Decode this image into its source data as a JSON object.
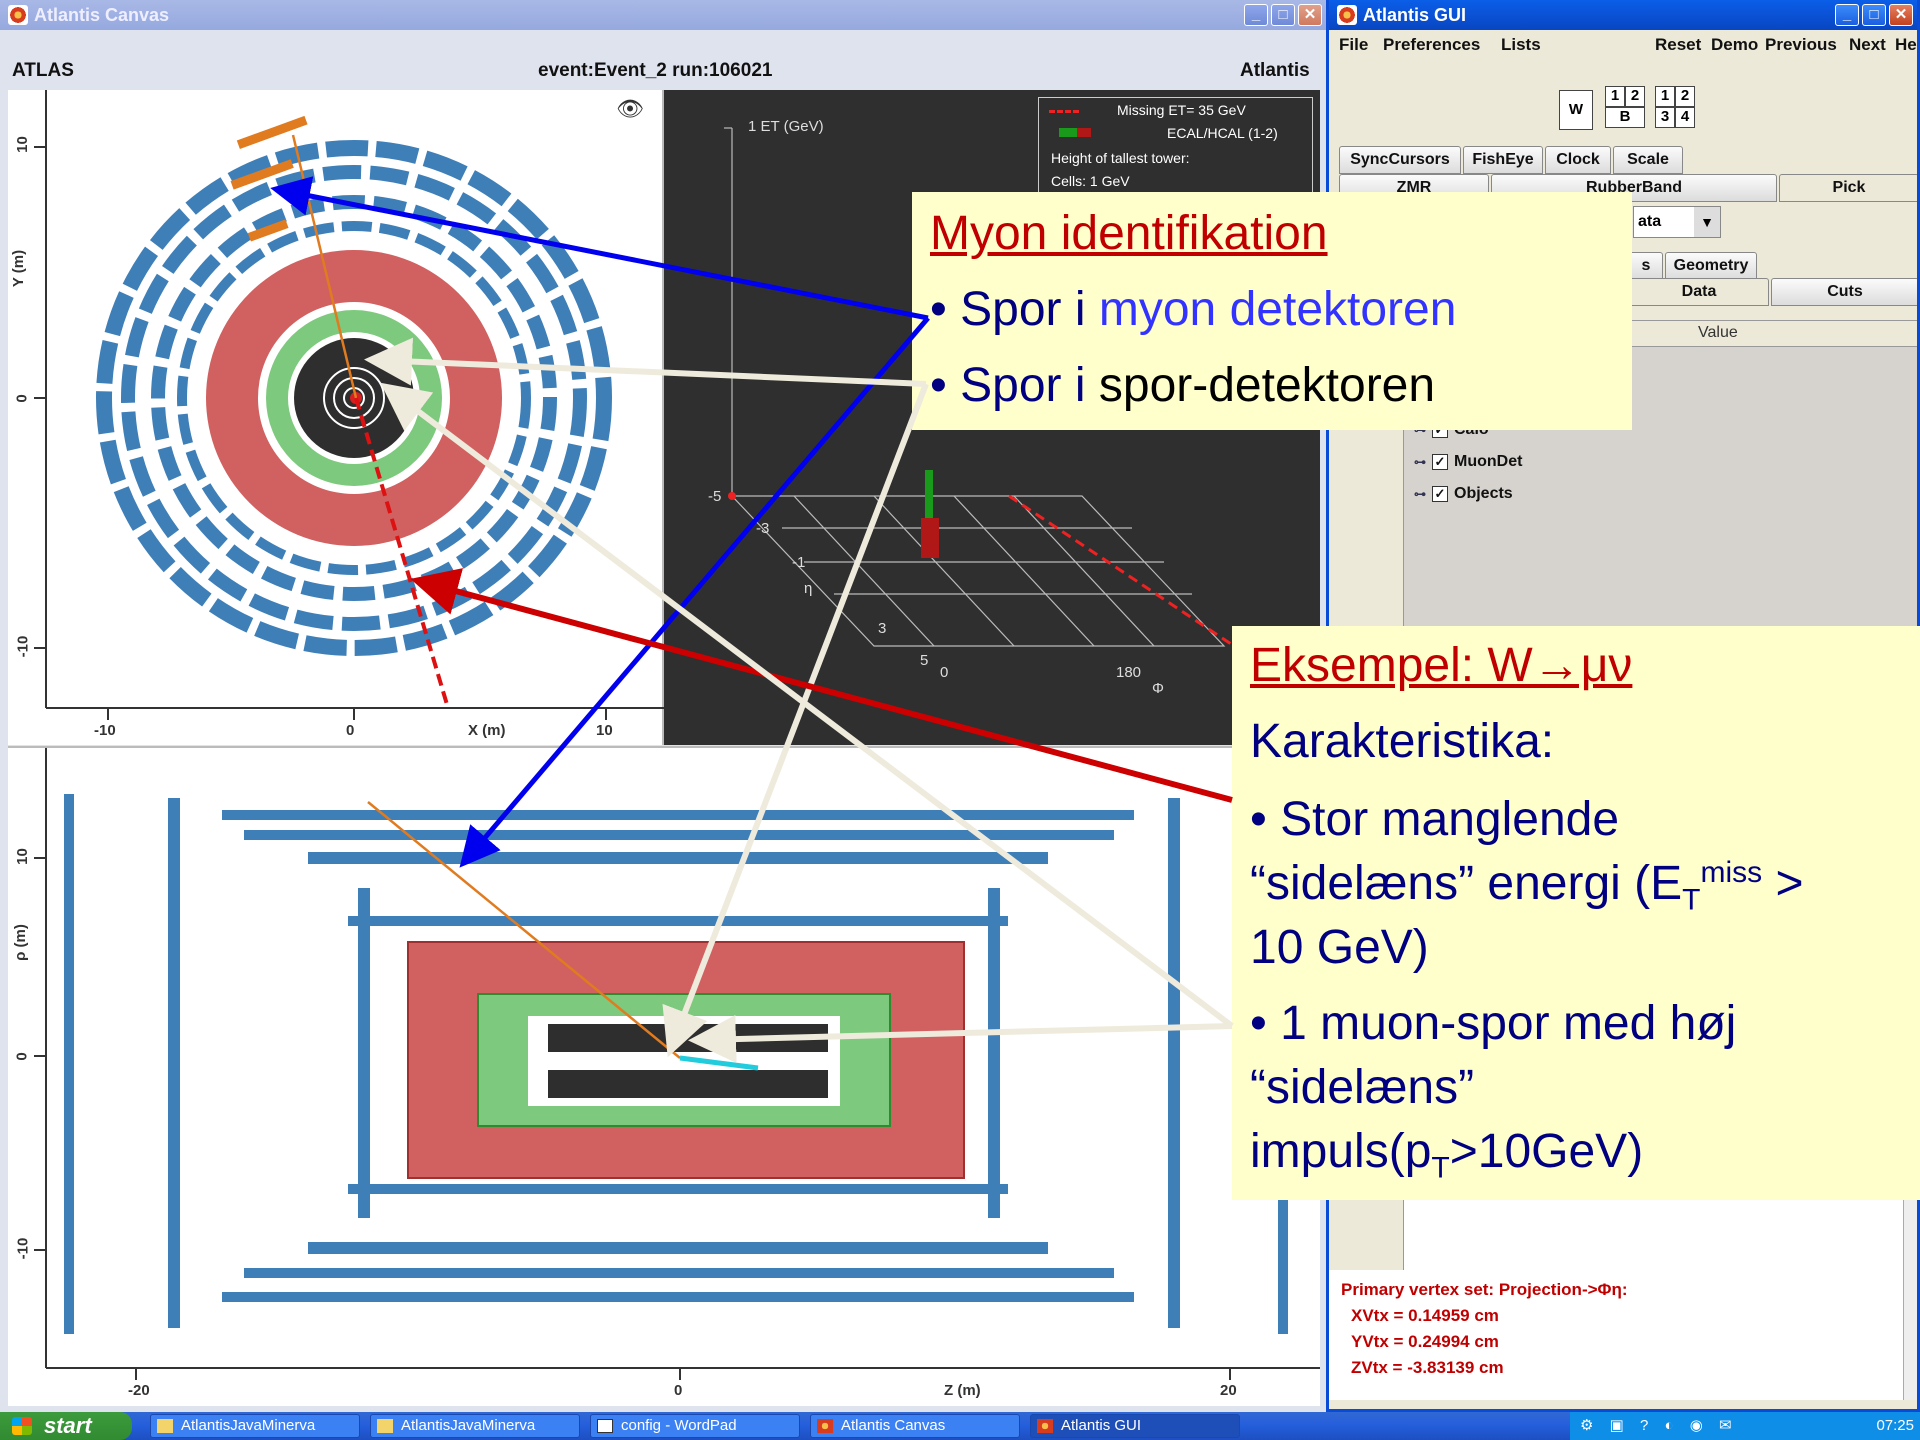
{
  "canvas_window": {
    "title": "Atlantis Canvas",
    "header_left": "ATLAS",
    "header_center": "event:Event_2 run:106021",
    "header_right": "Atlantis",
    "xy_view": {
      "y_axis_label": "Y (m)",
      "x_axis_label": "X (m)",
      "x_ticks": [
        "-10",
        "0",
        "10"
      ],
      "y_ticks": [
        "10",
        "0",
        "-10"
      ]
    },
    "lego_view": {
      "et_label": "1 ET (GeV)",
      "eta_label": "η",
      "phi_label": "Φ",
      "eta_ticks": [
        "-5",
        "-3",
        "-1",
        "3",
        "5"
      ],
      "phi_ticks": [
        "0",
        "180"
      ],
      "legend": {
        "missing_et": "Missing ET= 35 GeV",
        "ecal_hcal": "ECAL/HCAL (1-2)",
        "tallest_tower": "Height of tallest tower:",
        "cells": "Cells: 1 GeV"
      }
    },
    "rz_view": {
      "y_axis_label": "ρ (m)",
      "x_axis_label": "Z (m)",
      "x_ticks": [
        "-20",
        "0",
        "20"
      ],
      "y_ticks": [
        "10",
        "0",
        "-10"
      ]
    }
  },
  "gui_window": {
    "title": "Atlantis GUI",
    "menu": [
      "File",
      "Preferences",
      "Lists"
    ],
    "menu_right": [
      "Reset",
      "Demo",
      "Previous",
      "Next",
      "Help"
    ],
    "layout_buttons": {
      "w": "W",
      "grid_a": [
        "1",
        "2",
        "B"
      ],
      "grid_b": [
        "1",
        "2",
        "3",
        "4"
      ]
    },
    "tabs_row1": [
      "SyncCursors",
      "FishEye",
      "Clock",
      "Scale"
    ],
    "tabs_row2": [
      "ZMR",
      "RubberBand",
      "Pick"
    ],
    "dropdown_value": "ata",
    "tabs_row3": [
      "s",
      "Geometry"
    ],
    "tabs_row4": [
      "Data",
      "Cuts"
    ],
    "table_header": "Value",
    "tree": [
      "Calo",
      "MuonDet",
      "Objects"
    ],
    "vertex": {
      "line1": "Primary vertex set: Projection->Φη:",
      "line2": "XVtx = 0.14959 cm",
      "line3": "YVtx = 0.24994 cm",
      "line4": "ZVtx = -3.83139 cm"
    }
  },
  "note_muon": {
    "title": "Myon identifikation",
    "bullet1_prefix": "• Spor i ",
    "bullet1_highlight": "myon detektoren",
    "bullet2_prefix": "• Spor i ",
    "bullet2_rest": "spor-detektoren"
  },
  "note_example": {
    "title": "Eksempel: W→μν",
    "line1": "Karakteristika:",
    "line2": "• Stor manglende",
    "line3a": "“sidelæns” energi (E",
    "line3sub": "T",
    "line3sup": "miss",
    "line3b": " >",
    "line4": "10 GeV)",
    "line5": "• 1 muon-spor med høj",
    "line6": "“sidelæns”",
    "line7a": "impuls(p",
    "line7sub": "T",
    "line7b": ">10GeV)"
  },
  "taskbar": {
    "start": "start",
    "tasks": [
      "AtlantisJavaMinerva",
      "AtlantisJavaMinerva",
      "config - WordPad",
      "Atlantis Canvas",
      "Atlantis GUI"
    ],
    "clock": "07:25"
  },
  "colors": {
    "note_bg": "#ffffcc",
    "note_title": "#c00000",
    "note_text": "#000080",
    "note_highlight": "#3333ff",
    "arrow_blue": "#0000ee",
    "arrow_red": "#cc0000",
    "arrow_white": "#eeeadc",
    "muon_chamber": "#3f7fb8",
    "calo_red": "#d16060",
    "calo_green": "#7dc97d"
  }
}
